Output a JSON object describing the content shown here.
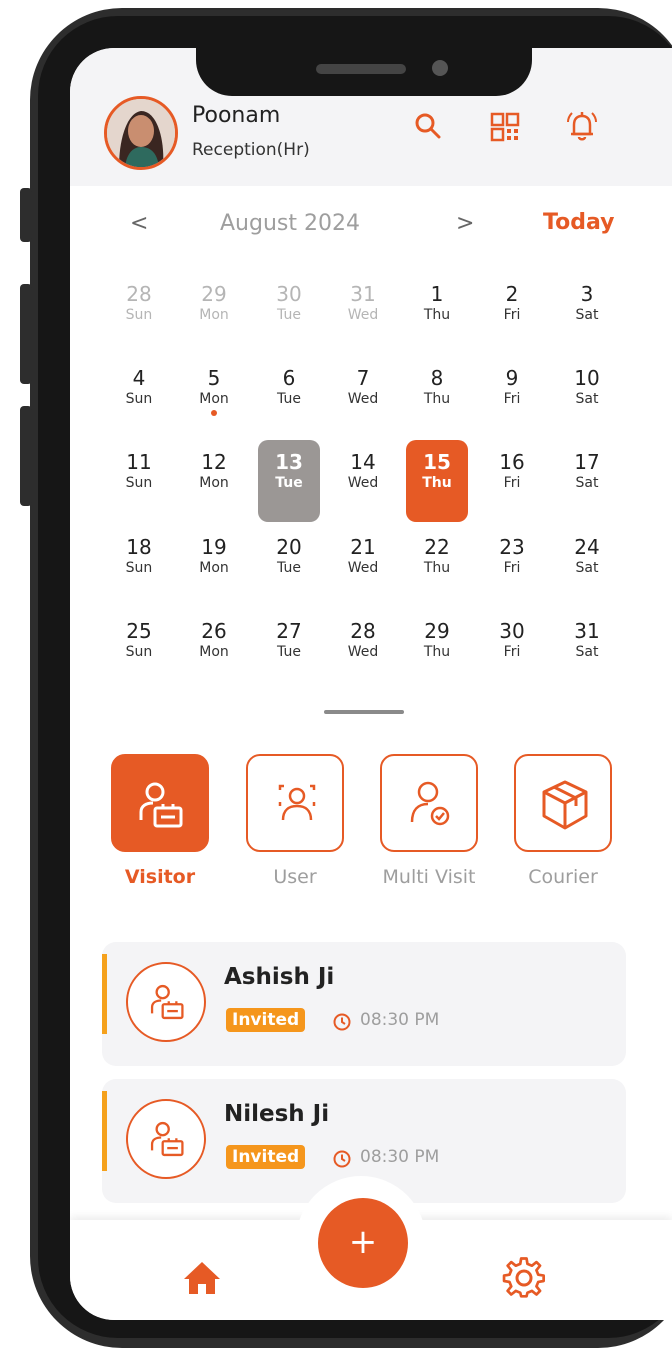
{
  "theme": {
    "accent": "#e65a25",
    "badge": "#f5961c"
  },
  "header": {
    "name": "Poonam",
    "role": "Reception(Hr)",
    "icons": [
      "search-icon",
      "qr-code-icon",
      "bell-icon"
    ]
  },
  "calendar": {
    "prev": "<",
    "next": ">",
    "month": "August  2024",
    "today": "Today",
    "selected": "15",
    "weeks": [
      [
        {
          "d": "28",
          "w": "Sun",
          "muted": true
        },
        {
          "d": "29",
          "w": "Mon",
          "muted": true
        },
        {
          "d": "30",
          "w": "Tue",
          "muted": true
        },
        {
          "d": "31",
          "w": "Wed",
          "muted": true
        },
        {
          "d": "1",
          "w": "Thu"
        },
        {
          "d": "2",
          "w": "Fri"
        },
        {
          "d": "3",
          "w": "Sat"
        }
      ],
      [
        {
          "d": "4",
          "w": "Sun"
        },
        {
          "d": "5",
          "w": "Mon",
          "dot": true
        },
        {
          "d": "6",
          "w": "Tue"
        },
        {
          "d": "7",
          "w": "Wed"
        },
        {
          "d": "8",
          "w": "Thu"
        },
        {
          "d": "9",
          "w": "Fri"
        },
        {
          "d": "10",
          "w": "Sat"
        }
      ],
      [
        {
          "d": "11",
          "w": "Sun"
        },
        {
          "d": "12",
          "w": "Mon"
        },
        {
          "d": "13",
          "w": "Tue",
          "style": "grey"
        },
        {
          "d": "14",
          "w": "Wed"
        },
        {
          "d": "15",
          "w": "Thu",
          "style": "orange"
        },
        {
          "d": "16",
          "w": "Fri"
        },
        {
          "d": "17",
          "w": "Sat"
        }
      ],
      [
        {
          "d": "18",
          "w": "Sun"
        },
        {
          "d": "19",
          "w": "Mon"
        },
        {
          "d": "20",
          "w": "Tue"
        },
        {
          "d": "21",
          "w": "Wed"
        },
        {
          "d": "22",
          "w": "Thu"
        },
        {
          "d": "23",
          "w": "Fri"
        },
        {
          "d": "24",
          "w": "Sat"
        }
      ],
      [
        {
          "d": "25",
          "w": "Sun"
        },
        {
          "d": "26",
          "w": "Mon"
        },
        {
          "d": "27",
          "w": "Tue"
        },
        {
          "d": "28",
          "w": "Wed"
        },
        {
          "d": "29",
          "w": "Thu"
        },
        {
          "d": "30",
          "w": "Fri"
        },
        {
          "d": "31",
          "w": "Sat"
        }
      ]
    ]
  },
  "categories": [
    {
      "label": "Visitor",
      "icon": "visitor-icon",
      "active": true
    },
    {
      "label": "User",
      "icon": "user-icon",
      "active": false
    },
    {
      "label": "Multi Visit",
      "icon": "multi-visit-icon",
      "active": false
    },
    {
      "label": "Courier",
      "icon": "courier-box-icon",
      "active": false
    }
  ],
  "visits": [
    {
      "name": "Ashish Ji",
      "status": "Invited",
      "time": "08:30 PM"
    },
    {
      "name": "Nilesh Ji",
      "status": "Invited",
      "time": "08:30 PM"
    }
  ],
  "nav": {
    "fab": "+",
    "items": [
      "home-icon",
      "settings-icon"
    ]
  }
}
